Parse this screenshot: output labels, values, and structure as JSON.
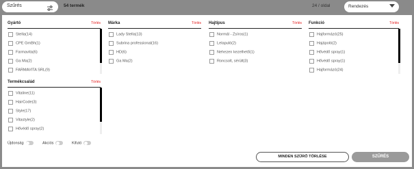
{
  "topbar": {
    "filter_label": "Szűrés",
    "product_count": "54 termék",
    "per_page": "24 / oldal",
    "sort_label": "Rendezés"
  },
  "groups": {
    "gyarto": {
      "title": "Gyártó",
      "clear": "Törlés",
      "items": [
        "Stella(14)",
        "CPE GmBh(1)",
        "Farmavita(6)",
        "Ga Ma(2)",
        "FARMAVITA SRL(9)"
      ]
    },
    "marka": {
      "title": "Márka",
      "clear": "Törlés",
      "items": [
        "Lady Stella(13)",
        "Subrina professional(16)",
        "HD(6)",
        "Ga Ma(2)"
      ]
    },
    "hajtipus": {
      "title": "Hajtípus",
      "clear": "Törlés",
      "items": [
        "Normál - Zsíros(1)",
        "Lelapuló(2)",
        "Nehezen kezelhető(1)",
        "Roncsolt, sérült(3)"
      ]
    },
    "funkcio": {
      "title": "Funkció",
      "clear": "Törlés",
      "items": [
        "Hajformázó(25)",
        "Hajápoló(2)",
        "Hővédő spray(1)",
        "Hővédő spray(1)",
        "Hajformázó(24)"
      ]
    },
    "termekcsalad": {
      "title": "Termékcsalád",
      "clear": "Törlés",
      "items": [
        "Vitaline(11)",
        "HairCode(3)",
        "Style(17)",
        "Vitastyle(2)",
        "Hővédő spray(2)"
      ]
    }
  },
  "toggles": {
    "new": "Újdonság",
    "sale": "Akciós",
    "discontinued": "Kifutó"
  },
  "buttons": {
    "clear_all": "MINDEN SZŰRŐ TÖRLÉSE",
    "apply": "SZŰRÉS"
  }
}
